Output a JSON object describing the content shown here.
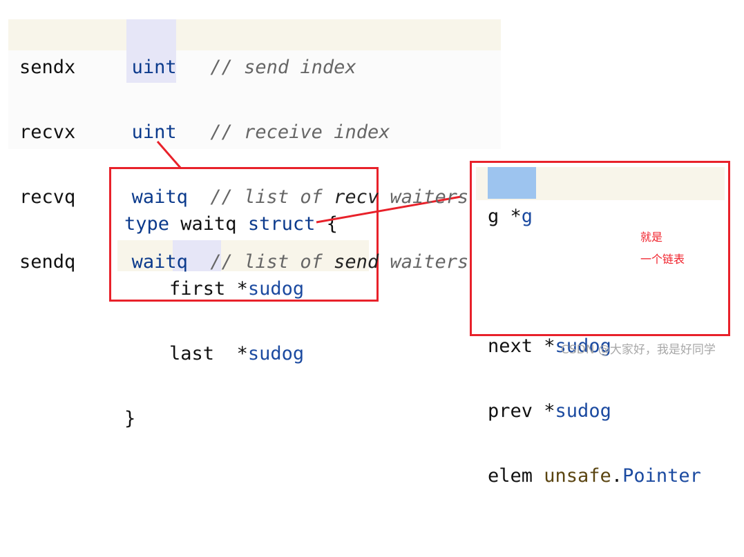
{
  "struct_fields": [
    {
      "name": "sendx",
      "type": "uint",
      "comment_prefix": "// send index",
      "comment_bold": "",
      "comment_suffix": ""
    },
    {
      "name": "recvx",
      "type": "uint",
      "comment_prefix": "// receive index",
      "comment_bold": "",
      "comment_suffix": ""
    },
    {
      "name": "recvq",
      "type": "waitq",
      "comment_prefix": "// list of ",
      "comment_bold": "recv",
      "comment_suffix": " waiters"
    },
    {
      "name": "sendq",
      "type": "waitq",
      "comment_prefix": "// list of ",
      "comment_bold": "send",
      "comment_suffix": " waiters"
    }
  ],
  "waitq_box": {
    "line1_kw": "type",
    "line1_name": " waitq ",
    "line1_kw2": "struct",
    "line1_brace": " {",
    "first_name": "first *",
    "first_type": "sudog",
    "last_name": "last  *",
    "last_type": "sudog",
    "close": "}"
  },
  "sudog_box": {
    "g_name": "g *",
    "g_type": "g",
    "next_name": "next *",
    "next_type": "sudog",
    "prev_name": "prev *",
    "prev_type": "sudog",
    "elem_name": "elem ",
    "elem_pkg": "unsafe",
    "elem_dot": ".",
    "elem_type": "Pointer"
  },
  "annotation": {
    "line1": "就是",
    "line2": "一个链表",
    "color": "#f0202a"
  },
  "watermark": "CSDN @大家好，我是好同学"
}
